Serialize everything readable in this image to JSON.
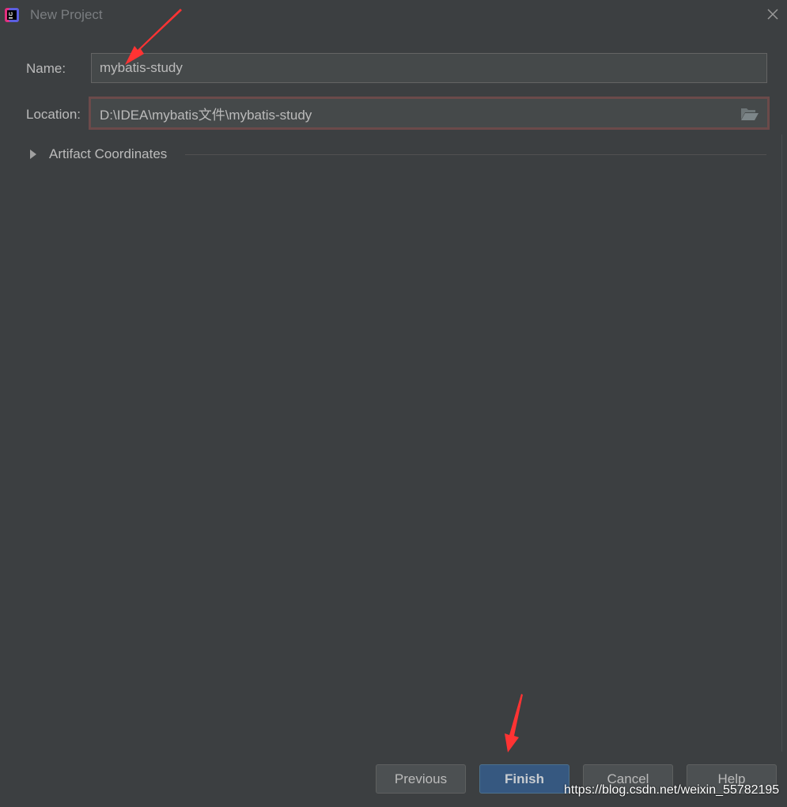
{
  "window": {
    "title": "New Project",
    "app_icon": "intellij-idea-icon",
    "close_icon": "close-icon"
  },
  "form": {
    "name_label": "Name:",
    "name_value": "mybatis-study",
    "location_label": "Location:",
    "location_value": "D:\\IDEA\\mybatis文件\\mybatis-study",
    "browse_icon": "folder-open-icon",
    "artifact_section": "Artifact Coordinates"
  },
  "buttons": {
    "previous": "Previous",
    "finish": "Finish",
    "cancel": "Cancel",
    "help": "Help"
  },
  "watermark": "https://blog.csdn.net/weixin_55782195",
  "colors": {
    "background": "#3c3f41",
    "primary_button": "#365880",
    "annotation_arrow": "#ff3333",
    "location_error_border": "#6b4a4a"
  }
}
